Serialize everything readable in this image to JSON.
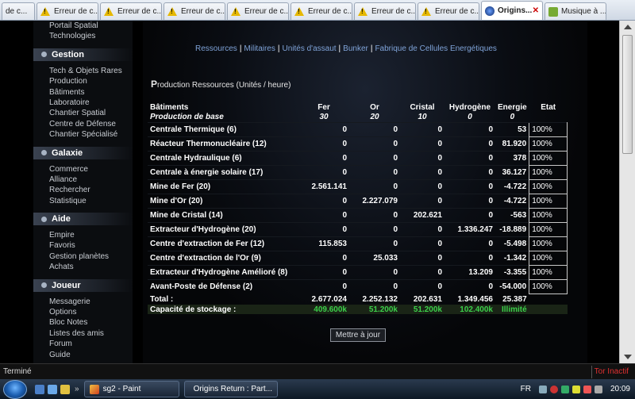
{
  "tabs": [
    {
      "label": "de c..."
    },
    {
      "label": "Erreur de c..."
    },
    {
      "label": "Erreur de c..."
    },
    {
      "label": "Erreur de c..."
    },
    {
      "label": "Erreur de c..."
    },
    {
      "label": "Erreur de c..."
    },
    {
      "label": "Erreur de c..."
    },
    {
      "label": "Erreur de c..."
    },
    {
      "label": "Origins..."
    },
    {
      "label": "Musique à ..."
    }
  ],
  "sidebar": {
    "top_links": [
      "Portail Spatial",
      "Technologies"
    ],
    "groups": [
      {
        "title": "Gestion",
        "items": [
          "Tech & Objets Rares",
          "Production",
          "Bâtiments",
          "Laboratoire",
          "Chantier Spatial",
          "Centre de Défense",
          "Chantier Spécialisé"
        ]
      },
      {
        "title": "Galaxie",
        "items": [
          "Commerce",
          "Alliance",
          "Rechercher",
          "Statistique"
        ]
      },
      {
        "title": "Aide",
        "items": [
          "Empire",
          "Favoris",
          "Gestion planètes",
          "Achats"
        ]
      },
      {
        "title": "Joueur",
        "items": [
          "Messagerie",
          "Options",
          "Bloc Notes",
          "Listes des amis",
          "Forum",
          "Guide"
        ]
      }
    ]
  },
  "nav": [
    "Ressources",
    "Militaires",
    "Unités d'assaut",
    "Bunker",
    "Fabrique de Cellules Energétiques"
  ],
  "section_title": {
    "first_letter": "P",
    "rest": "roduction Ressources (Unités / heure)"
  },
  "table": {
    "headers": [
      "Bâtiments",
      "Fer",
      "Or",
      "Cristal",
      "Hydrogène",
      "Energie",
      "Etat"
    ],
    "base": {
      "name": "Production de base",
      "values": [
        "30",
        "20",
        "10",
        "0",
        "0"
      ]
    },
    "rows": [
      {
        "name": "Centrale Thermique (6)",
        "values": [
          "0",
          "0",
          "0",
          "0",
          "53"
        ],
        "etat": "100%"
      },
      {
        "name": "Réacteur Thermonucléaire (12)",
        "values": [
          "0",
          "0",
          "0",
          "0",
          "81.920"
        ],
        "etat": "100%"
      },
      {
        "name": "Centrale Hydraulique (6)",
        "values": [
          "0",
          "0",
          "0",
          "0",
          "378"
        ],
        "etat": "100%"
      },
      {
        "name": "Centrale à énergie solaire (17)",
        "values": [
          "0",
          "0",
          "0",
          "0",
          "36.127"
        ],
        "etat": "100%"
      },
      {
        "name": "Mine de Fer (20)",
        "values": [
          "2.561.141",
          "0",
          "0",
          "0",
          "-4.722"
        ],
        "etat": "100%"
      },
      {
        "name": "Mine d'Or (20)",
        "values": [
          "0",
          "2.227.079",
          "0",
          "0",
          "-4.722"
        ],
        "etat": "100%"
      },
      {
        "name": "Mine de Cristal (14)",
        "values": [
          "0",
          "0",
          "202.621",
          "0",
          "-563"
        ],
        "etat": "100%"
      },
      {
        "name": "Extracteur d'Hydrogène (20)",
        "values": [
          "0",
          "0",
          "0",
          "1.336.247",
          "-18.889"
        ],
        "etat": "100%"
      },
      {
        "name": "Centre d'extraction de Fer (12)",
        "values": [
          "115.853",
          "0",
          "0",
          "0",
          "-5.498"
        ],
        "etat": "100%"
      },
      {
        "name": "Centre d'extraction de l'Or (9)",
        "values": [
          "0",
          "25.033",
          "0",
          "0",
          "-1.342"
        ],
        "etat": "100%"
      },
      {
        "name": "Extracteur d'Hydrogène Amélioré (8)",
        "values": [
          "0",
          "0",
          "0",
          "13.209",
          "-3.355"
        ],
        "etat": "100%"
      },
      {
        "name": "Avant-Poste de Défense (2)",
        "values": [
          "0",
          "0",
          "0",
          "0",
          "-54.000"
        ],
        "etat": "100%"
      }
    ],
    "total": {
      "label": "Total :",
      "values": [
        "2.677.024",
        "2.252.132",
        "202.631",
        "1.349.456",
        "25.387"
      ]
    },
    "storage": {
      "label": "Capacité de stockage :",
      "values": [
        "409.600k",
        "51.200k",
        "51.200k",
        "102.400k",
        "Illimité"
      ]
    }
  },
  "update_button": "Mettre à jour",
  "status": {
    "left": "Terminé",
    "right": "Tor Inactif"
  },
  "taskbar": {
    "tasks": [
      "sg2 - Paint",
      "Origins Return : Part..."
    ],
    "lang": "FR",
    "clock": "20:09"
  }
}
